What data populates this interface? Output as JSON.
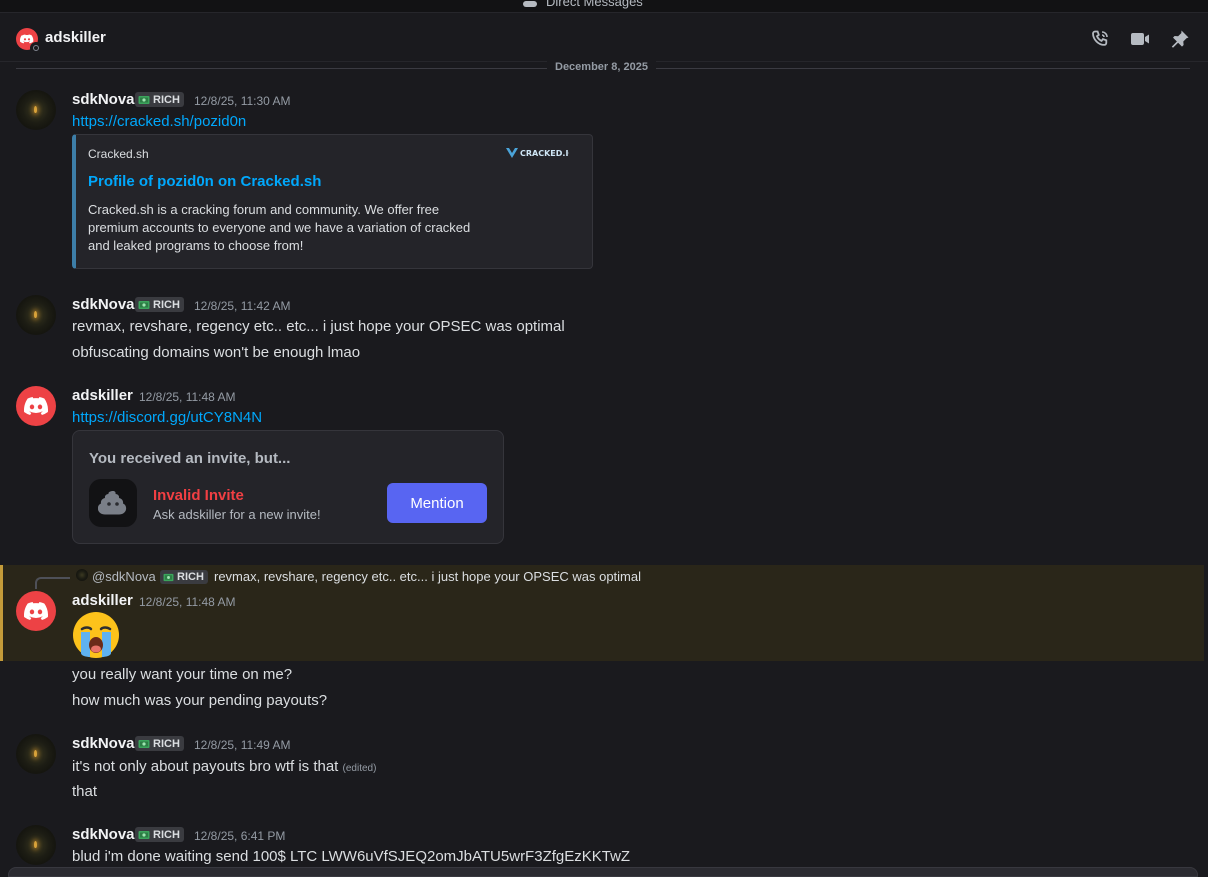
{
  "topbar": {
    "title": "Direct Messages"
  },
  "header": {
    "name": "adskiller",
    "icons": [
      "phone-call-icon",
      "video-icon",
      "pin-icon"
    ]
  },
  "date_divider": "December 8, 2025",
  "messages": [
    {
      "author": "sdkNova",
      "tag": "RICH",
      "timestamp": "12/8/25, 11:30 AM",
      "link": "https://cracked.sh/pozid0n",
      "embed": {
        "provider": "Cracked.sh",
        "title": "Profile of pozid0n on Cracked.sh",
        "description": "Cracked.sh is a cracking forum and community. We offer free premium accounts to everyone and we have a variation of cracked and leaked programs to choose from!",
        "thumbnail_text": "CRACKED.IO"
      }
    },
    {
      "author": "sdkNova",
      "tag": "RICH",
      "timestamp": "12/8/25, 11:42 AM",
      "lines": [
        "revmax, revshare, regency etc.. etc... i just hope your OPSEC was optimal",
        "obfuscating domains won't be enough lmao"
      ]
    },
    {
      "author": "adskiller",
      "timestamp": "12/8/25, 11:48 AM",
      "link": "https://discord.gg/utCY8N4N",
      "invite": {
        "heading": "You received an invite, but...",
        "title": "Invalid Invite",
        "subtitle": "Ask adskiller for a new invite!",
        "button": "Mention"
      }
    },
    {
      "reply": {
        "name": "@sdkNova",
        "tag": "RICH",
        "text": "revmax, revshare, regency etc.. etc... i just hope your OPSEC was optimal"
      },
      "author": "adskiller",
      "timestamp": "12/8/25, 11:48 AM",
      "emoji": "loudly-crying-face",
      "lines": [
        "you really want your time on me?",
        "how much was your pending payouts?"
      ]
    },
    {
      "author": "sdkNova",
      "tag": "RICH",
      "timestamp": "12/8/25, 11:49 AM",
      "lines": [
        "it's not only about payouts bro wtf is that",
        "that"
      ],
      "edited": "(edited)"
    },
    {
      "author": "sdkNova",
      "tag": "RICH",
      "timestamp": "12/8/25, 6:41 PM",
      "lines": [
        "blud i'm done waiting send 100$ LTC LWW6uVfSJEQ2omJbATU5wrF3ZfgEzKKTwZ"
      ]
    }
  ],
  "colors": {
    "background": "#1a1a1e",
    "link": "#00a8fc",
    "discord_red": "#ed4245",
    "blurple": "#5865f2",
    "invalid": "#f23f43",
    "mention_highlight": "#2a2619",
    "mention_bar": "#c49b3a"
  }
}
